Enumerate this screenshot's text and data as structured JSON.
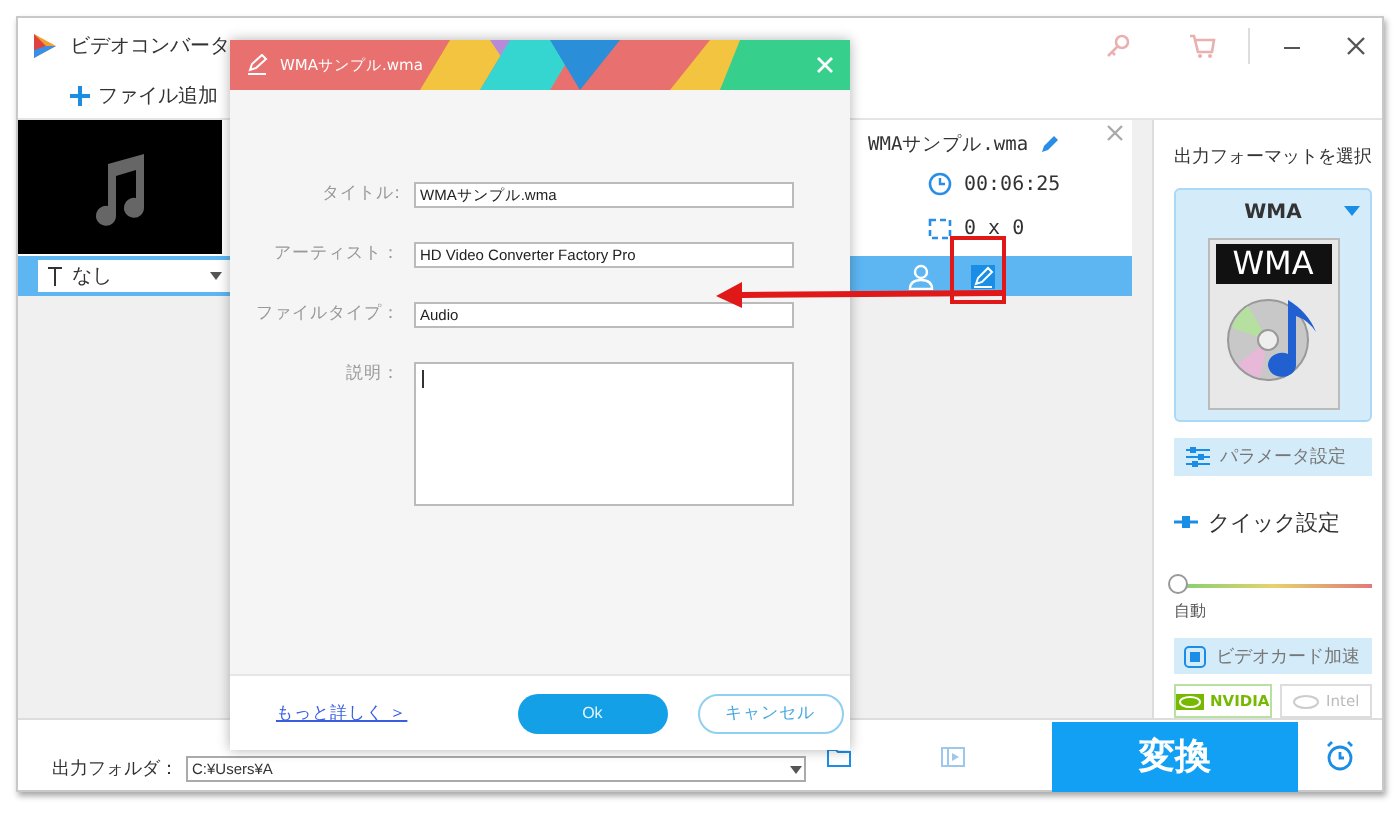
{
  "window": {
    "title": "ビデオコンバータ"
  },
  "toolbar": {
    "add_file": "ファイル追加"
  },
  "file_item": {
    "name": "WMAサンプル.wma",
    "duration": "00:06:25",
    "resolution": "0 x 0",
    "subtitle": "なし"
  },
  "right_panel": {
    "heading": "出力フォーマットを選択",
    "format": "WMA",
    "format_icon_text": "WMA",
    "parameter_button": "パラメータ設定",
    "quick_setting": "クイック設定",
    "quality": {
      "level": 0,
      "label": "自動"
    },
    "gpu_button": "ビデオカード加速",
    "gpu_options": [
      {
        "label": "NVIDIA",
        "selected": true
      },
      {
        "label": "Intel",
        "selected": false
      }
    ]
  },
  "bottom_bar": {
    "output_label": "出力フォルダ：",
    "output_path": "C:¥Users¥A",
    "convert": "変換"
  },
  "dialog": {
    "title": "WMAサンプル.wma",
    "fields": [
      {
        "label": "タイトル:",
        "value": "WMAサンプル.wma",
        "kind": "input"
      },
      {
        "label": "アーティスト：",
        "value": "HD Video Converter Factory Pro",
        "kind": "input"
      },
      {
        "label": "ファイルタイプ：",
        "value": "Audio",
        "kind": "input"
      },
      {
        "label": "説明：",
        "kind": "textarea"
      }
    ],
    "link": "もっと詳しく ＞",
    "ok": "Ok",
    "cancel": "キャンセル"
  }
}
